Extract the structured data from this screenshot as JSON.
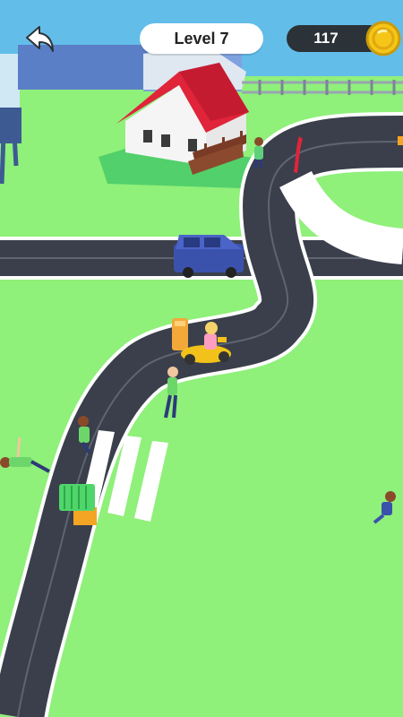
{
  "hud": {
    "level_label": "Level 7",
    "coins": "117"
  },
  "icons": {
    "back": "back-arrow-icon",
    "coin": "gold-coin-icon"
  },
  "colors": {
    "grass": "#8ff07a",
    "road": "#3a3f4b",
    "roof": "#e0243a",
    "van": "#4a64c8",
    "scooter": "#f2c21a",
    "cash": "#4fd66a",
    "coin": "#f5c518"
  }
}
